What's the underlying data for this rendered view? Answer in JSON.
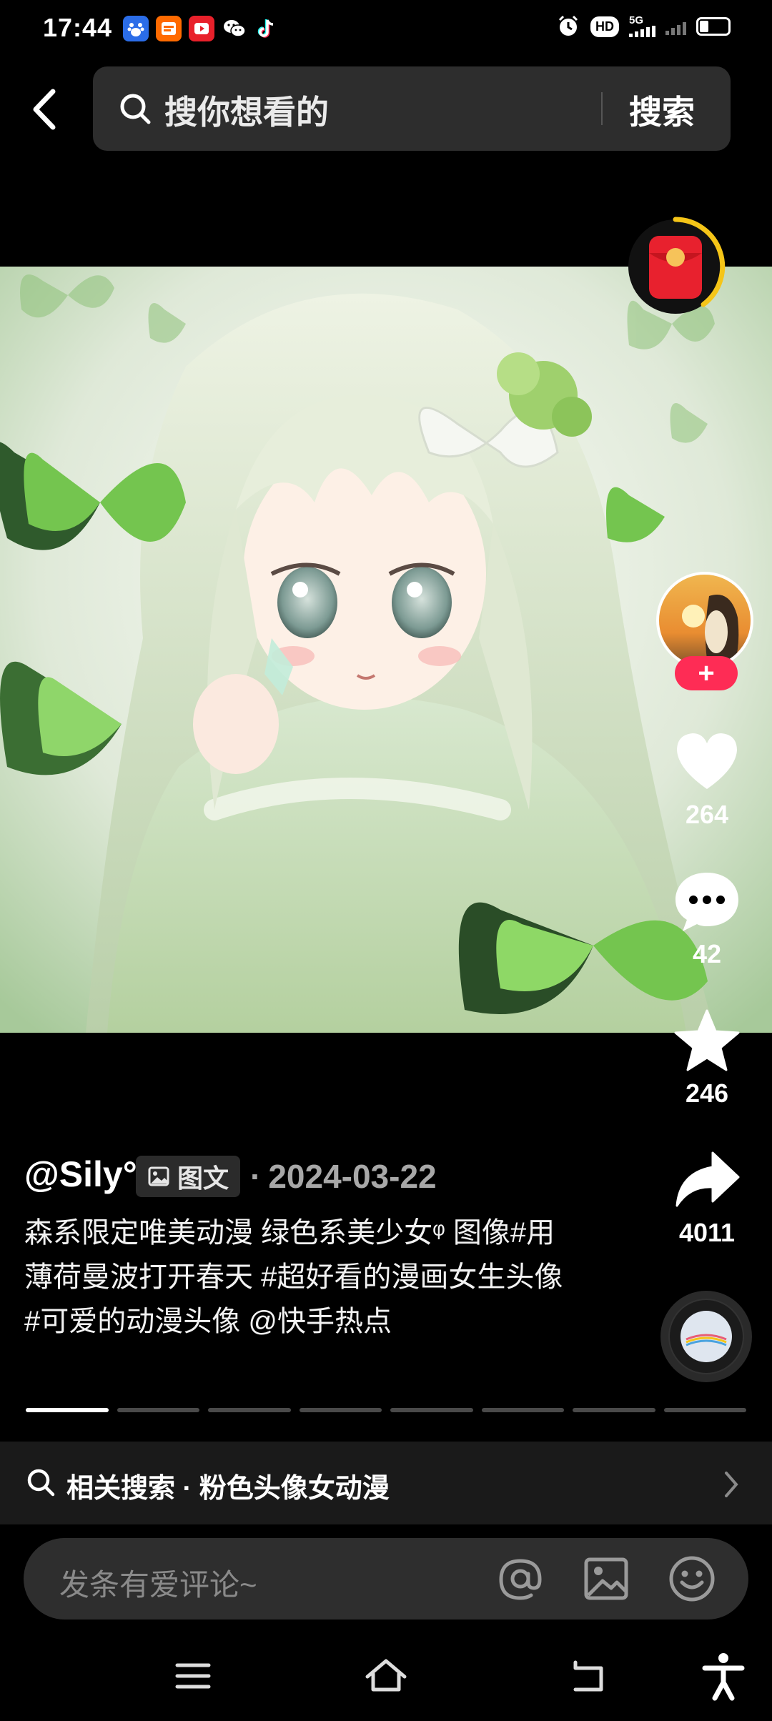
{
  "status_bar": {
    "time": "17:44",
    "network_label": "5G",
    "hd_label": "HD"
  },
  "search": {
    "placeholder": "搜你想看的",
    "button_label": "搜索"
  },
  "post": {
    "author": "@Sily°",
    "type_badge": "图文",
    "date_separator": "·",
    "date": "2024-03-22",
    "caption": "森系限定唯美动漫 绿色系美少女ᵠ 图像#用薄荷曼波打开春天 #超好看的漫画女生头像 #可爱的动漫头像 @快手热点",
    "image_count": 8,
    "current_image": 1
  },
  "actions": {
    "follow_label": "+",
    "likes": "264",
    "comments": "42",
    "favorites": "246",
    "shares": "4011"
  },
  "related_search": {
    "label": "相关搜索 · 粉色头像女动漫"
  },
  "comment_bar": {
    "placeholder": "发条有爱评论~"
  },
  "colors": {
    "accent": "#fe2c55",
    "background": "#000000",
    "search_bg": "#2d2d2d",
    "comment_bg": "#2e2e2e",
    "red_packet": "#e8212e",
    "ring": "#f5c518"
  },
  "icons": {
    "back": "back-arrow-icon",
    "search": "search-icon",
    "like": "heart-icon",
    "comment": "comment-bubble-icon",
    "favorite": "star-icon",
    "share": "share-arrow-icon",
    "music": "music-disc-icon",
    "mention": "at-icon",
    "image": "image-icon",
    "emoji": "emoji-icon"
  }
}
